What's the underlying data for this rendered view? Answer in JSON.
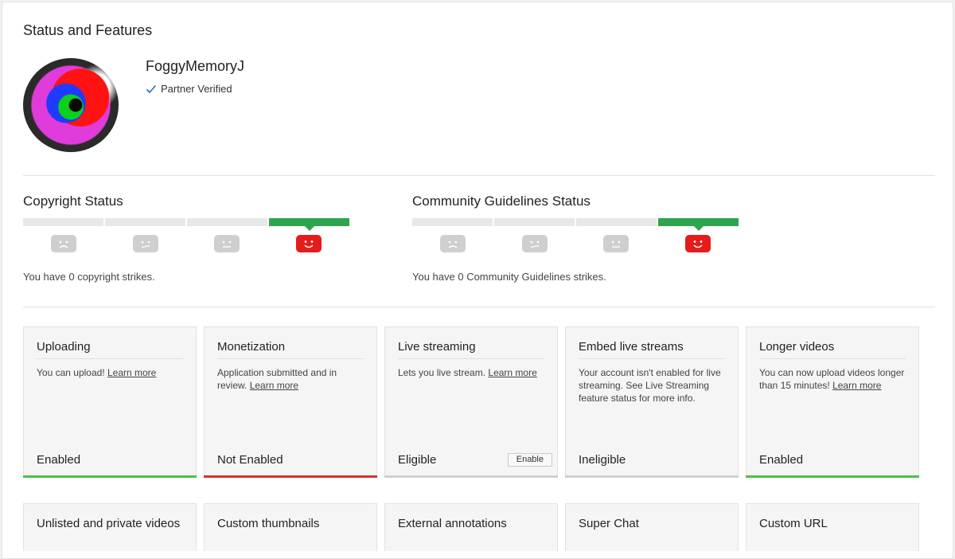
{
  "page": {
    "title": "Status and Features"
  },
  "channel": {
    "name": "FoggyMemoryJ",
    "verified_label": "Partner Verified"
  },
  "copyright": {
    "title": "Copyright Status",
    "strikes_text": "You have 0 copyright strikes.",
    "active_segment": 4
  },
  "community": {
    "title": "Community Guidelines Status",
    "strikes_text": "You have 0 Community Guidelines strikes.",
    "active_segment": 4
  },
  "colors": {
    "active_green": "#2ea44f",
    "active_red": "#e51c1c",
    "enabled_bar": "#46c541",
    "not_enabled_bar": "#d4332b"
  },
  "features": [
    {
      "title": "Uploading",
      "desc": "You can upload!",
      "link": "Learn more",
      "state": "Enabled",
      "status": "enabled"
    },
    {
      "title": "Monetization",
      "desc": "Application submitted and in review.",
      "link": "Learn more",
      "state": "Not Enabled",
      "status": "not-enabled"
    },
    {
      "title": "Live streaming",
      "desc": "Lets you live stream.",
      "link": "Learn more",
      "state": "Eligible",
      "status": "eligible",
      "button": "Enable"
    },
    {
      "title": "Embed live streams",
      "desc": "Your account isn't enabled for live streaming. See Live Streaming feature status for more info.",
      "link": "",
      "state": "Ineligible",
      "status": "ineligible"
    },
    {
      "title": "Longer videos",
      "desc": "You can now upload videos longer than 15 minutes!",
      "link": "Learn more",
      "state": "Enabled",
      "status": "enabled"
    }
  ],
  "features_row2": [
    {
      "title": "Unlisted and private videos"
    },
    {
      "title": "Custom thumbnails"
    },
    {
      "title": "External annotations"
    },
    {
      "title": "Super Chat"
    },
    {
      "title": "Custom URL"
    }
  ]
}
